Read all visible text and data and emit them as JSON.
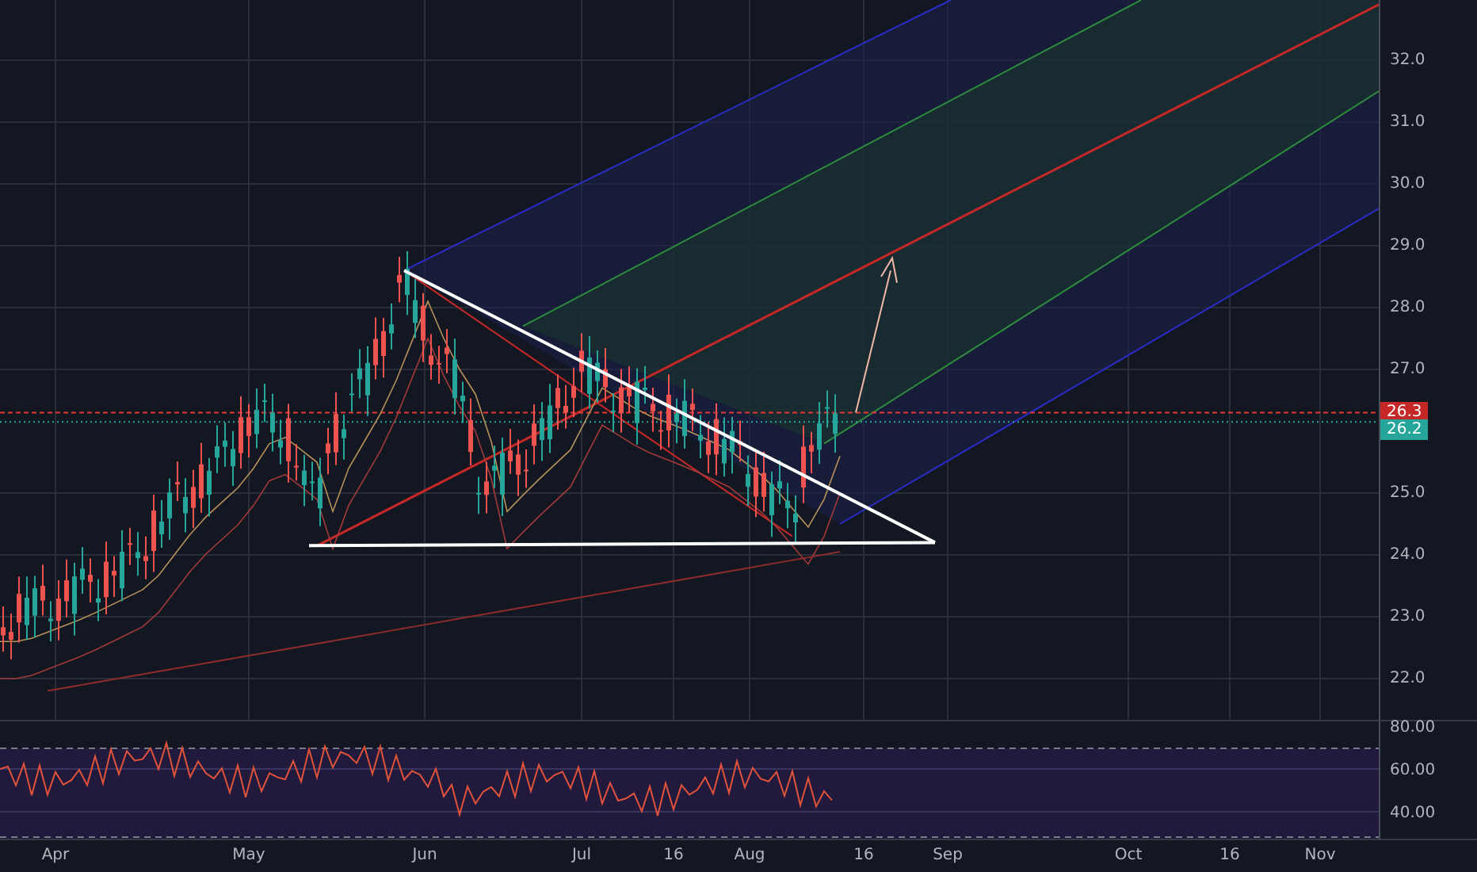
{
  "price_axis": {
    "labels": [
      "32.0",
      "31.0",
      "30.0",
      "29.0",
      "28.0",
      "27.0",
      "25.0",
      "24.0",
      "23.0",
      "22.0"
    ]
  },
  "price_tags": [
    {
      "label": "26.3",
      "color": "#c62828"
    },
    {
      "label": "26.2",
      "color": "#26a69a"
    }
  ],
  "rsi_axis": {
    "labels": [
      "80.00",
      "60.00",
      "40.00"
    ]
  },
  "time_axis": {
    "labels": [
      "Apr",
      "May",
      "Jun",
      "Jul",
      "16",
      "Aug",
      "16",
      "Sep",
      "Oct",
      "16",
      "Nov"
    ]
  }
}
